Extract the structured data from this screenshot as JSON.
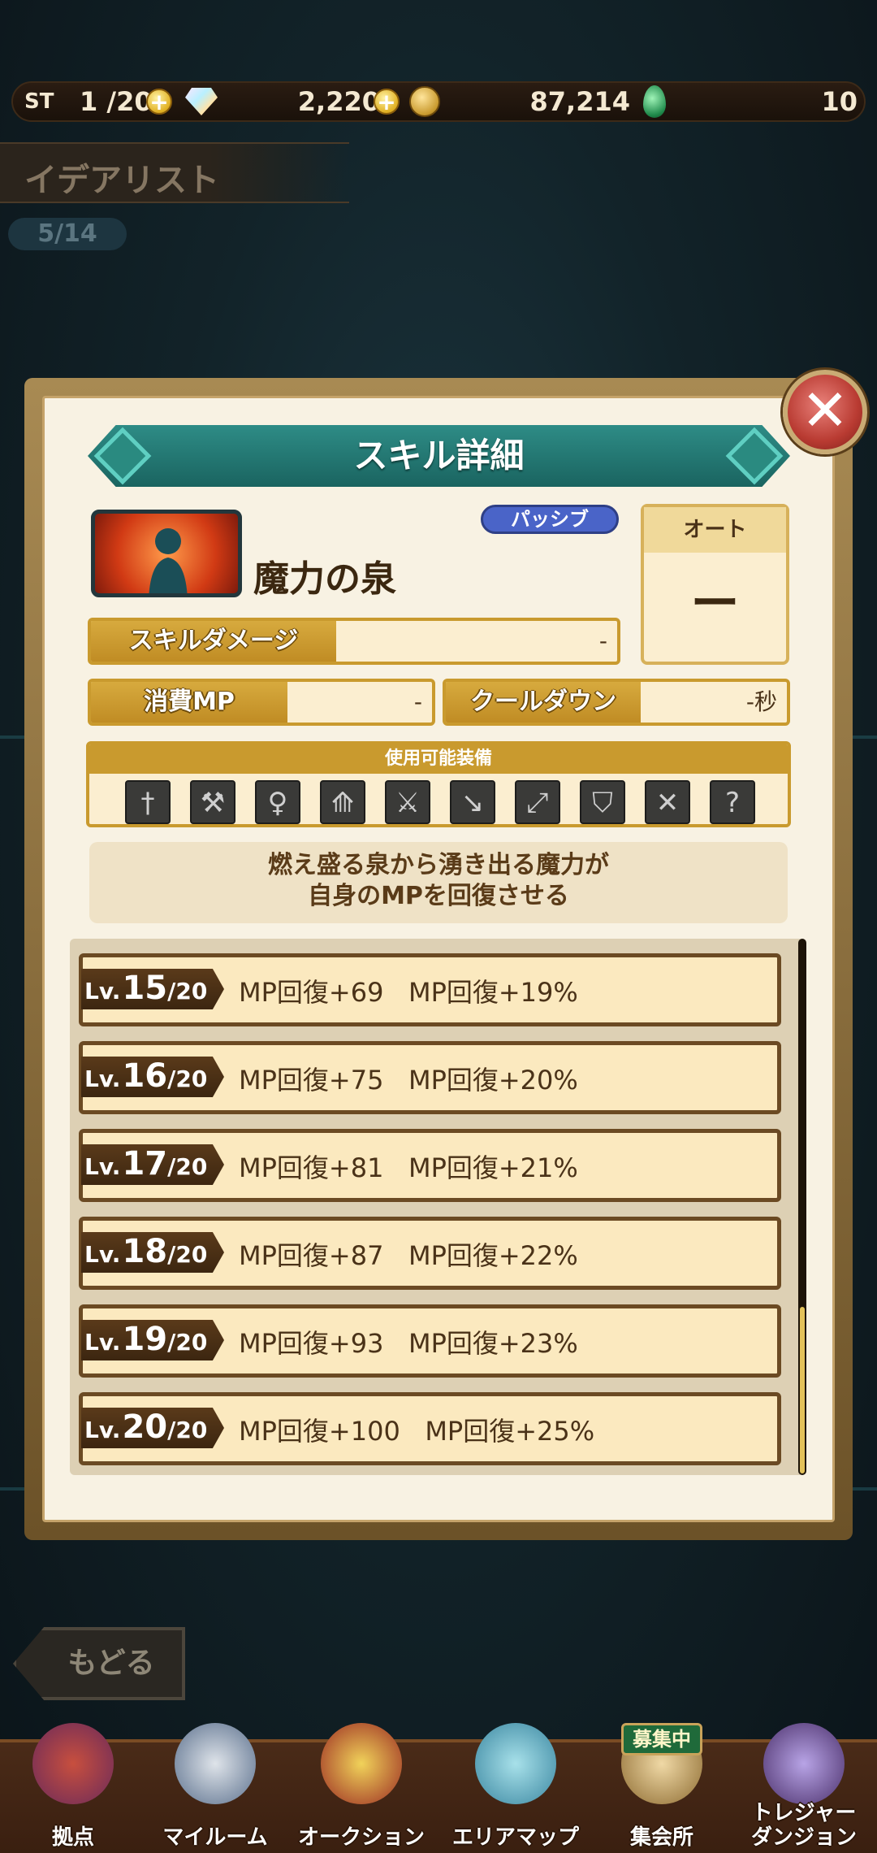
{
  "status": {
    "st_label": "ST",
    "st_value": "1 /20",
    "gems": "2,220",
    "coins": "87,214",
    "green": "10"
  },
  "page": {
    "title": "イデアリスト",
    "count": "5/14"
  },
  "modal": {
    "title": "スキル詳細",
    "skill_name": "魔力の泉",
    "skill_type": "パッシブ",
    "auto_label": "オート",
    "auto_value": "ー",
    "damage_label": "スキルダメージ",
    "damage_value": "-",
    "mp_label": "消費MP",
    "mp_value": "-",
    "cooldown_label": "クールダウン",
    "cooldown_value": "-秒",
    "equip_title": "使用可能装備",
    "equip_icons": [
      "sword-icon",
      "axe-icon",
      "staff-icon",
      "dagger-icon",
      "battle-axe-icon",
      "spear-icon",
      "bow-icon",
      "shield-icon",
      "dual-swords-icon",
      "unknown-icon"
    ],
    "description_line1": "燃え盛る泉から湧き出る魔力が",
    "description_line2": "自身のMPを回復させる",
    "levels": [
      {
        "prefix": "Lv.",
        "level": "15",
        "max": "/20",
        "effect": "MP回復+69   MP回復+19%"
      },
      {
        "prefix": "Lv.",
        "level": "16",
        "max": "/20",
        "effect": "MP回復+75   MP回復+20%"
      },
      {
        "prefix": "Lv.",
        "level": "17",
        "max": "/20",
        "effect": "MP回復+81   MP回復+21%"
      },
      {
        "prefix": "Lv.",
        "level": "18",
        "max": "/20",
        "effect": "MP回復+87   MP回復+22%"
      },
      {
        "prefix": "Lv.",
        "level": "19",
        "max": "/20",
        "effect": "MP回復+93   MP回復+23%"
      },
      {
        "prefix": "Lv.",
        "level": "20",
        "max": "/20",
        "effect": "MP回復+100   MP回復+25%"
      }
    ]
  },
  "back_label": "もどる",
  "nav": {
    "items": [
      {
        "label": "拠点"
      },
      {
        "label": "マイルーム"
      },
      {
        "label": "オークション"
      },
      {
        "label": "エリアマップ"
      },
      {
        "label": "集会所"
      },
      {
        "label_line1": "トレジャー",
        "label_line2": "ダンジョン"
      }
    ],
    "recruit_badge": "募集中"
  },
  "colors": {
    "accent_teal": "#1a6460",
    "gold": "#c99a2e",
    "passive_blue": "#4a64c8",
    "close_red": "#b93b32"
  }
}
